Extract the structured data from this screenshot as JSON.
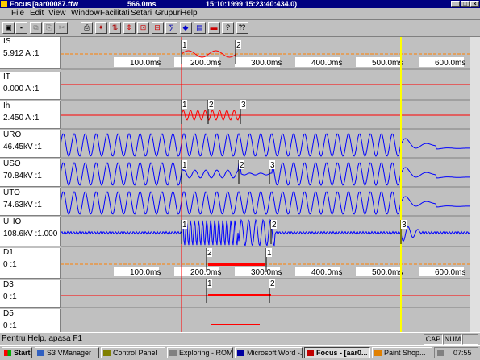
{
  "window": {
    "app": "Focus",
    "file": "[aar00087.ffw",
    "duration": "566.0ms",
    "timestamp": "15:10:1999 15:23:40:434.0)",
    "min_label": "_",
    "max_label": "□",
    "close_label": "×"
  },
  "menu": [
    "File",
    "Edit",
    "View",
    "Window",
    "Facilitati",
    "Setari",
    "Grupuri",
    "Help"
  ],
  "toolbar_icons": [
    "open-icon",
    "save-icon",
    "copy-icon",
    "paste-icon",
    "cut-icon",
    "print-icon",
    "cursor-icon",
    "marker-icon",
    "zoom-icon",
    "calc-icon",
    "ruler-icon",
    "math-icon",
    "vector-icon",
    "fft-icon",
    "display-icon",
    "help-icon",
    "context-help-icon"
  ],
  "toolbar_glyphs": [
    "▣",
    "▪",
    "⧉",
    "⎘",
    "✂",
    "⎙",
    "✦",
    "⇅",
    "⇕",
    "⊡",
    "⊟",
    "∑",
    "◆",
    "▤",
    "▬",
    "?",
    "⁇"
  ],
  "time_axis": [
    "100.0ms",
    "200.0ms",
    "300.0ms",
    "400.0ms",
    "500.0ms",
    "600.0ms"
  ],
  "channels": [
    {
      "name": "IS",
      "value": "5.912 A :1"
    },
    {
      "name": "IT",
      "value": "0.000 A :1"
    },
    {
      "name": "Ih",
      "value": "2.450 A :1"
    },
    {
      "name": "URO",
      "value": "46.45kV :1"
    },
    {
      "name": "USO",
      "value": "70.84kV :1"
    },
    {
      "name": "UTO",
      "value": "74.63kV :1"
    },
    {
      "name": "UHO",
      "value": "108.6kV :1.000"
    },
    {
      "name": "D1",
      "value": "0 :1"
    },
    {
      "name": "D3",
      "value": "0 :1"
    },
    {
      "name": "D5",
      "value": "0 :1"
    }
  ],
  "markers": {
    "m1": "1",
    "m2": "2",
    "m3": "3"
  },
  "status": {
    "text": "Pentru Help, apasa F1",
    "cap": "CAP",
    "num": "NUM"
  },
  "taskbar": {
    "start": "Start",
    "items": [
      "S3 VManager",
      "Control Panel",
      "Exploring - ROM...",
      "Microsoft Word -...",
      "Focus - [aar0...",
      "Paint Shop..."
    ],
    "clock": "07:55"
  },
  "colors": {
    "waveform": "#0000ff",
    "trace": "#ff0000",
    "cursor_red": "#ff0000",
    "cursor_yellow": "#ffff00",
    "title_bg": "#000080"
  }
}
